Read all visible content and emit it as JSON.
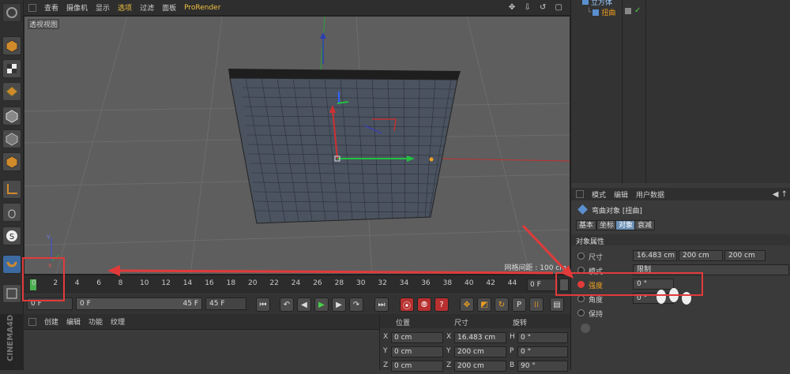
{
  "menubar": {
    "items": [
      "查看",
      "摄像机",
      "显示",
      "选项",
      "过滤",
      "面板",
      "ProRender"
    ],
    "active_index": 3
  },
  "viewport": {
    "label": "透视视图",
    "grid_info": "网格间距 : 100 cm"
  },
  "timeline": {
    "ticks": [
      "0",
      "2",
      "4",
      "6",
      "8",
      "10",
      "12",
      "14",
      "16",
      "18",
      "20",
      "22",
      "24",
      "26",
      "28",
      "30",
      "32",
      "34",
      "36",
      "38",
      "40",
      "42",
      "44"
    ],
    "current_frame": "0 F"
  },
  "transport": {
    "start_field": "0 F",
    "range_start": "0 F",
    "range_end": "45 F",
    "end_field": "45 F"
  },
  "bottom_menu": {
    "items": [
      "创建",
      "编辑",
      "功能",
      "纹理"
    ]
  },
  "coords": {
    "headers": [
      "位置",
      "尺寸",
      "旋转"
    ],
    "rows": [
      {
        "axis": "X",
        "pos": "0 cm",
        "size_axis": "X",
        "size": "16.483 cm",
        "rot_axis": "H",
        "rot": "0 °"
      },
      {
        "axis": "Y",
        "pos": "0 cm",
        "size_axis": "Y",
        "size": "200 cm",
        "rot_axis": "P",
        "rot": "0 °"
      },
      {
        "axis": "Z",
        "pos": "0 cm",
        "size_axis": "Z",
        "size": "200 cm",
        "rot_axis": "B",
        "rot": "90 °"
      }
    ]
  },
  "object_manager": {
    "items": [
      {
        "label": "立方体"
      },
      {
        "label": "扭曲"
      }
    ]
  },
  "attributes": {
    "header_items": [
      "模式",
      "编辑",
      "用户数据"
    ],
    "object_title": "弯曲对象 [扭曲]",
    "tabs": [
      "基本",
      "坐标",
      "对象",
      "衰减"
    ],
    "active_tab": 2,
    "section": "对象属性",
    "size_label": "尺寸",
    "size_values": [
      "16.483 cm",
      "200 cm",
      "200 cm"
    ],
    "mode_label": "模式",
    "mode_value": "限制",
    "strength_label": "强度",
    "strength_value": "0 °",
    "angle_label": "角度",
    "angle_value": "0 °",
    "keep_label": "保持"
  },
  "logo": {
    "text": "CINEMA4D"
  },
  "colors": {
    "accent": "#f0c040",
    "highlight_red": "#e23a3a",
    "active_tab": "#6a8fb5"
  }
}
